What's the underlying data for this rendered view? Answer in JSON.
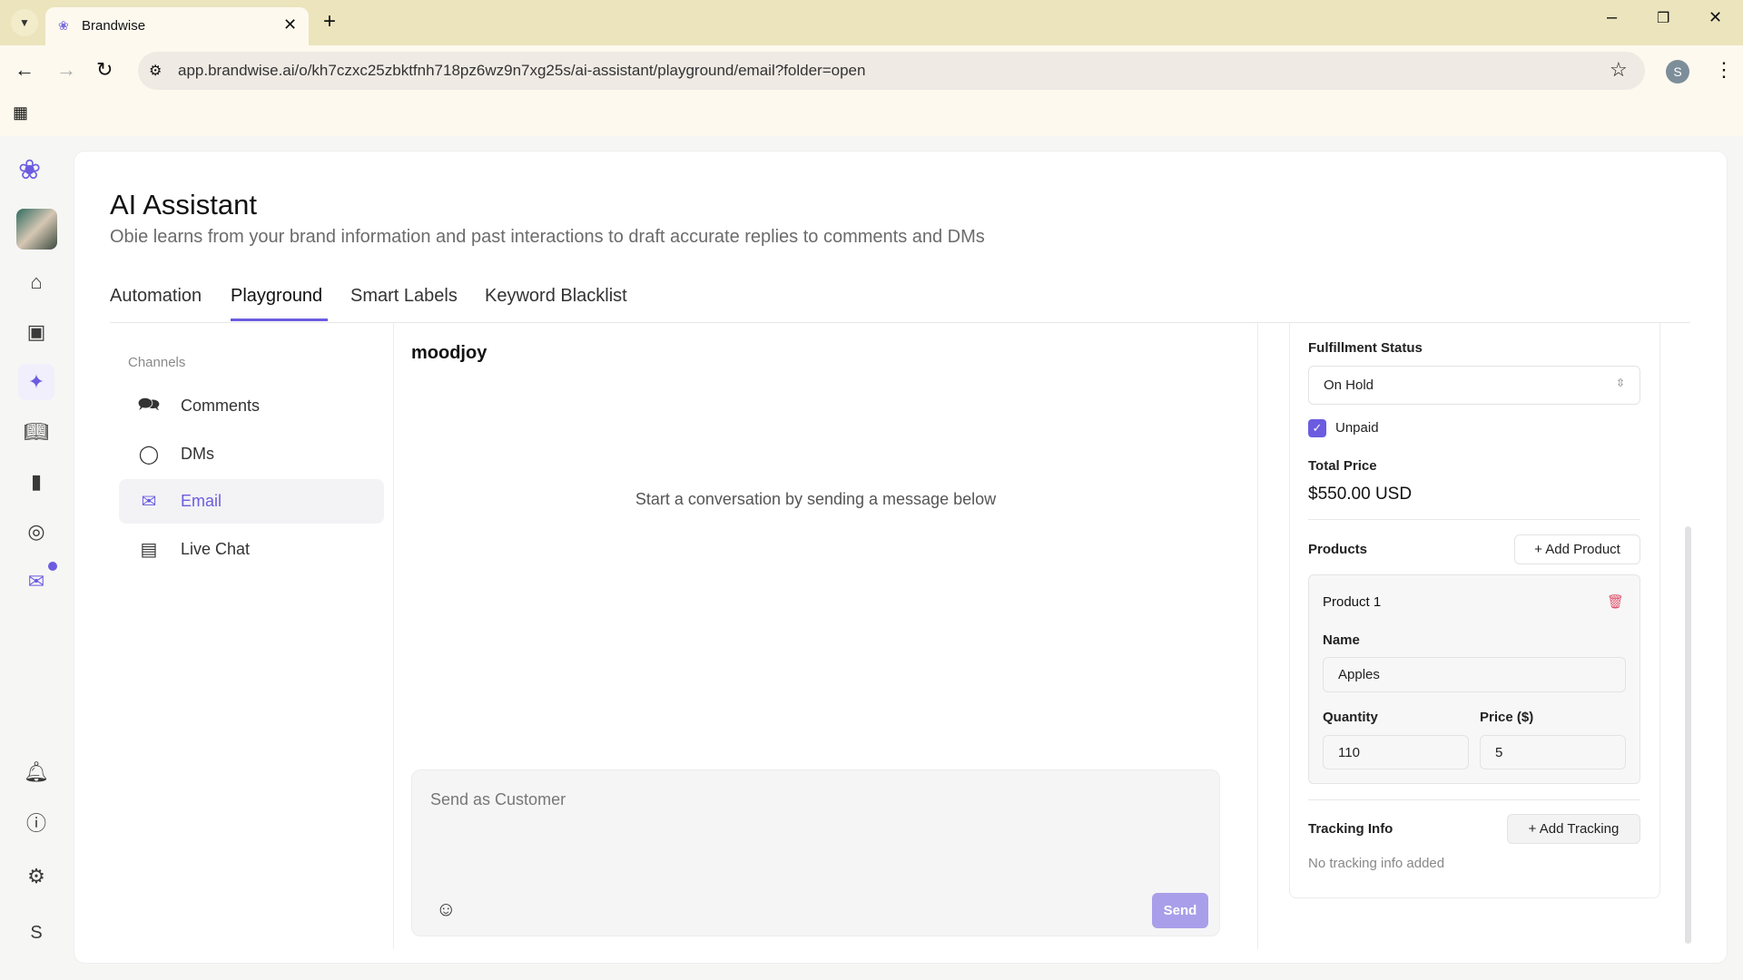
{
  "browser": {
    "tab_title": "Brandwise",
    "url": "app.brandwise.ai/o/kh7czxc25zbktfnh718pz6wz9n7xg25s/ai-assistant/playground/email?folder=open",
    "profile_initial": "S"
  },
  "nav": {
    "user_initial": "S"
  },
  "header": {
    "title": "AI Assistant",
    "subtitle": "Obie learns from your brand information and past interactions to draft accurate replies to comments and DMs"
  },
  "tabs": [
    {
      "label": "Automation"
    },
    {
      "label": "Playground"
    },
    {
      "label": "Smart Labels"
    },
    {
      "label": "Keyword Blacklist"
    }
  ],
  "channels": {
    "heading": "Channels",
    "items": [
      {
        "label": "Comments"
      },
      {
        "label": "DMs"
      },
      {
        "label": "Email"
      },
      {
        "label": "Live Chat"
      }
    ]
  },
  "chat": {
    "name": "moodjoy",
    "empty": "Start a conversation by sending a message below",
    "placeholder": "Send as Customer",
    "send": "Send"
  },
  "order": {
    "fulfillment_label": "Fulfillment Status",
    "fulfillment_value": "On Hold",
    "unpaid_label": "Unpaid",
    "total_label": "Total Price",
    "total_value": "$550.00 USD",
    "products_label": "Products",
    "add_product": "+ Add Product",
    "product": {
      "title": "Product 1",
      "name_label": "Name",
      "name": "Apples",
      "qty_label": "Quantity",
      "qty": "110",
      "price_label": "Price ($)",
      "price": "5"
    },
    "tracking_label": "Tracking Info",
    "add_tracking": "+ Add Tracking",
    "no_tracking": "No tracking info added"
  },
  "colors": {
    "accent": "#6b5ce0",
    "send": "#a99ee9",
    "delete": "#e0516a"
  }
}
